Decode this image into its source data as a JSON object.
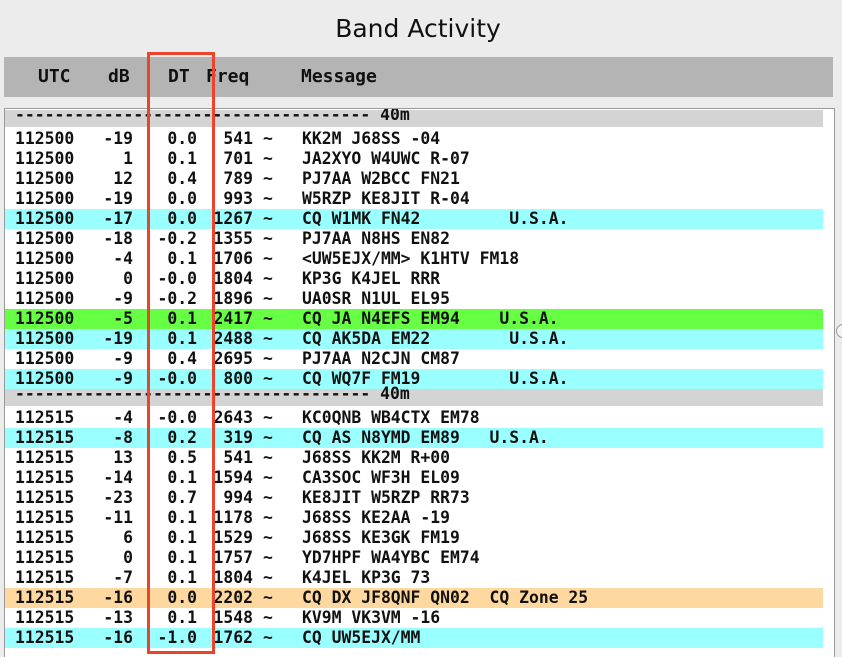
{
  "window": {
    "title": "Band Activity"
  },
  "colors": {
    "cq_highlight": "#99ffff",
    "my_call_highlight": "#66ff44",
    "cq_zone_highlight": "#ffd8a0",
    "separator": "#d4d4d4",
    "annotation_box": "#e8452c"
  },
  "header": {
    "utc": "UTC",
    "db": "dB",
    "dt": "DT",
    "freq": "Freq",
    "message": "Message"
  },
  "rows": [
    {
      "type": "sep",
      "text": "------------------------------------ 40m"
    },
    {
      "type": "msg",
      "hl": "",
      "utc": "112500",
      "db": "-19",
      "dt": "0.0",
      "freq": "541",
      "message": "KK2M J68SS -04"
    },
    {
      "type": "msg",
      "hl": "",
      "utc": "112500",
      "db": "1",
      "dt": "0.1",
      "freq": "701",
      "message": "JA2XYO W4UWC R-07"
    },
    {
      "type": "msg",
      "hl": "",
      "utc": "112500",
      "db": "12",
      "dt": "0.4",
      "freq": "789",
      "message": "PJ7AA W2BCC FN21"
    },
    {
      "type": "msg",
      "hl": "",
      "utc": "112500",
      "db": "-19",
      "dt": "0.0",
      "freq": "993",
      "message": "W5RZP KE8JIT R-04"
    },
    {
      "type": "msg",
      "hl": "cyan",
      "utc": "112500",
      "db": "-17",
      "dt": "0.0",
      "freq": "1267",
      "message": "CQ W1MK FN42         U.S.A."
    },
    {
      "type": "msg",
      "hl": "",
      "utc": "112500",
      "db": "-18",
      "dt": "-0.2",
      "freq": "1355",
      "message": "PJ7AA N8HS EN82"
    },
    {
      "type": "msg",
      "hl": "",
      "utc": "112500",
      "db": "-4",
      "dt": "0.1",
      "freq": "1706",
      "message": "<UW5EJX/MM> K1HTV FM18"
    },
    {
      "type": "msg",
      "hl": "",
      "utc": "112500",
      "db": "0",
      "dt": "-0.0",
      "freq": "1804",
      "message": "KP3G K4JEL RRR"
    },
    {
      "type": "msg",
      "hl": "",
      "utc": "112500",
      "db": "-9",
      "dt": "-0.2",
      "freq": "1896",
      "message": "UA0SR N1UL EL95"
    },
    {
      "type": "msg",
      "hl": "green",
      "utc": "112500",
      "db": "-5",
      "dt": "0.1",
      "freq": "2417",
      "message": "CQ JA N4EFS EM94    U.S.A."
    },
    {
      "type": "msg",
      "hl": "cyan",
      "utc": "112500",
      "db": "-19",
      "dt": "0.1",
      "freq": "2488",
      "message": "CQ AK5DA EM22        U.S.A."
    },
    {
      "type": "msg",
      "hl": "",
      "utc": "112500",
      "db": "-9",
      "dt": "0.4",
      "freq": "2695",
      "message": "PJ7AA N2CJN CM87"
    },
    {
      "type": "msg",
      "hl": "cyan",
      "utc": "112500",
      "db": "-9",
      "dt": "-0.0",
      "freq": "800",
      "message": "CQ WQ7F FM19         U.S.A."
    },
    {
      "type": "sep",
      "text": "------------------------------------ 40m"
    },
    {
      "type": "msg",
      "hl": "",
      "utc": "112515",
      "db": "-4",
      "dt": "-0.0",
      "freq": "2643",
      "message": "KC0QNB WB4CTX EM78"
    },
    {
      "type": "msg",
      "hl": "cyan",
      "utc": "112515",
      "db": "-8",
      "dt": "0.2",
      "freq": "319",
      "message": "CQ AS N8YMD EM89   U.S.A."
    },
    {
      "type": "msg",
      "hl": "",
      "utc": "112515",
      "db": "13",
      "dt": "0.5",
      "freq": "541",
      "message": "J68SS KK2M R+00"
    },
    {
      "type": "msg",
      "hl": "",
      "utc": "112515",
      "db": "-14",
      "dt": "0.1",
      "freq": "1594",
      "message": "CA3SOC WF3H EL09"
    },
    {
      "type": "msg",
      "hl": "",
      "utc": "112515",
      "db": "-23",
      "dt": "0.7",
      "freq": "994",
      "message": "KE8JIT W5RZP RR73"
    },
    {
      "type": "msg",
      "hl": "",
      "utc": "112515",
      "db": "-11",
      "dt": "0.1",
      "freq": "1178",
      "message": "J68SS KE2AA -19"
    },
    {
      "type": "msg",
      "hl": "",
      "utc": "112515",
      "db": "6",
      "dt": "0.1",
      "freq": "1529",
      "message": "J68SS KE3GK FM19"
    },
    {
      "type": "msg",
      "hl": "",
      "utc": "112515",
      "db": "0",
      "dt": "0.1",
      "freq": "1757",
      "message": "YD7HPF WA4YBC EM74"
    },
    {
      "type": "msg",
      "hl": "",
      "utc": "112515",
      "db": "-7",
      "dt": "0.1",
      "freq": "1804",
      "message": "K4JEL KP3G 73"
    },
    {
      "type": "msg",
      "hl": "orange",
      "utc": "112515",
      "db": "-16",
      "dt": "0.0",
      "freq": "2202",
      "message": "CQ DX JF8QNF QN02  CQ Zone 25"
    },
    {
      "type": "msg",
      "hl": "",
      "utc": "112515",
      "db": "-13",
      "dt": "0.1",
      "freq": "1548",
      "message": "KV9M VK3VM -16"
    },
    {
      "type": "msg",
      "hl": "cyan",
      "utc": "112515",
      "db": "-16",
      "dt": "-1.0",
      "freq": "1762",
      "message": "CQ UW5EJX/MM"
    }
  ]
}
